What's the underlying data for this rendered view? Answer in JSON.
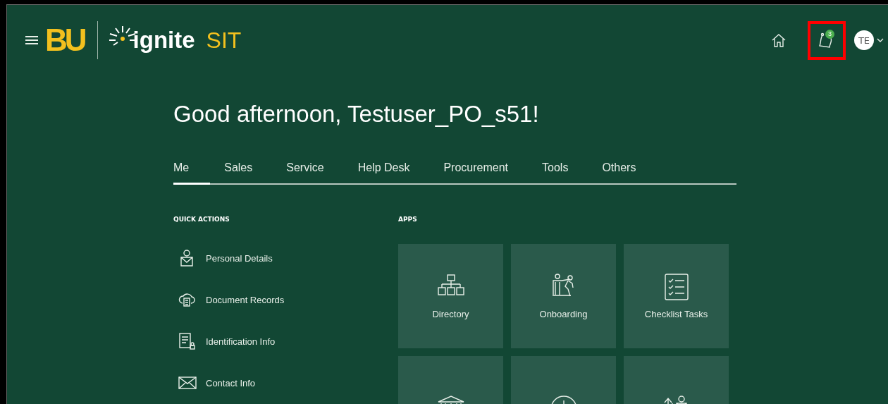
{
  "header": {
    "logo_letters": "BU",
    "product": "ignite",
    "environment": "SIT",
    "notifications": {
      "count": "3",
      "highlighted": true
    },
    "avatar": "TE"
  },
  "greeting": "Good afternoon, Testuser_PO_s51!",
  "tabs": [
    {
      "label": "Me",
      "selected": true
    },
    {
      "label": "Sales",
      "selected": false
    },
    {
      "label": "Service",
      "selected": false
    },
    {
      "label": "Help Desk",
      "selected": false
    },
    {
      "label": "Procurement",
      "selected": false
    },
    {
      "label": "Tools",
      "selected": false
    },
    {
      "label": "Others",
      "selected": false
    }
  ],
  "quick_actions": {
    "title": "QUICK ACTIONS",
    "items": [
      {
        "label": "Personal Details",
        "kind": "person"
      },
      {
        "label": "Document Records",
        "kind": "cloud"
      },
      {
        "label": "Identification Info",
        "kind": "id"
      },
      {
        "label": "Contact Info",
        "kind": "mail"
      }
    ]
  },
  "apps": {
    "title": "APPS",
    "tiles": [
      {
        "label": "Directory",
        "kind": "org"
      },
      {
        "label": "Onboarding",
        "kind": "people"
      },
      {
        "label": "Checklist Tasks",
        "kind": "checklist"
      },
      {
        "kind": "bank"
      },
      {
        "kind": "clock"
      },
      {
        "kind": "growth"
      }
    ]
  }
}
